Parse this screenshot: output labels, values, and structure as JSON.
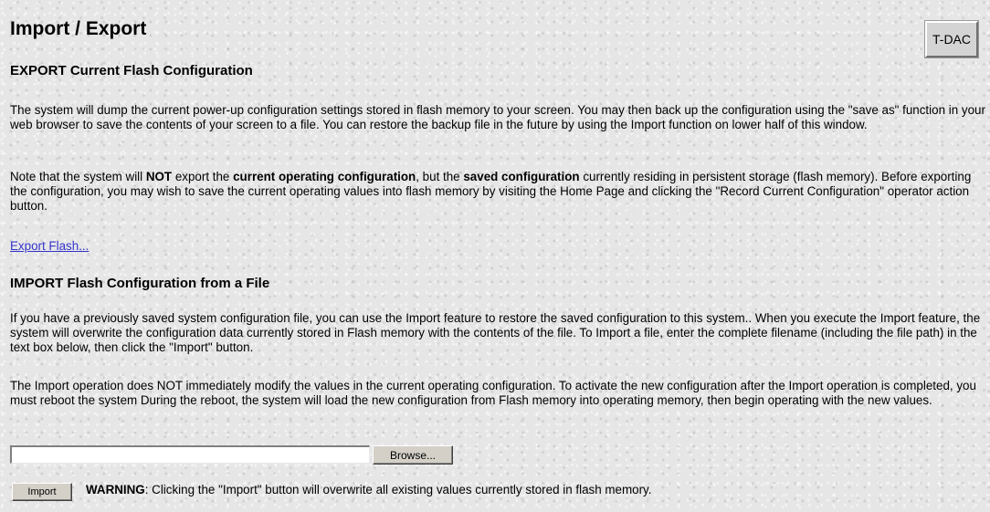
{
  "page": {
    "title": "Import / Export",
    "badge": "T-DAC"
  },
  "export": {
    "heading": "EXPORT Current Flash Configuration",
    "para1": "The system will dump the current power-up configuration settings stored in flash memory to your screen. You may then back up the configuration using the \"save as\" function in your web browser to save the contents of your screen to a file. You can restore the backup file in the future by using the Import function on lower half of this window.",
    "para2": {
      "t1": "Note that the system will ",
      "b1": "NOT",
      "t2": " export the ",
      "b2": "current operating configuration",
      "t3": ", but the ",
      "b3": "saved configuration",
      "t4": " currently residing in persistent storage (flash memory). Before exporting the configuration, you may wish to save the current operating values into flash memory by visiting the Home Page and clicking the \"Record Current Configuration\" operator action button."
    },
    "link": "Export Flash..."
  },
  "import": {
    "heading": "IMPORT Flash Configuration from a File",
    "para1": "If you have a previously saved system configuration file, you can use the Import feature to restore the saved configuration to this system.. When you execute the Import feature, the system will overwrite the configuration data currently stored in Flash memory with the contents of the file. To Import a file, enter the complete filename (including the file path) in the text box below, then click the \"Import\" button.",
    "para2": "The Import operation does NOT immediately modify the values in the current operating configuration. To activate the new configuration after the Import operation is completed, you must reboot the system During the reboot, the system will load the new configuration from Flash memory into operating memory, then begin operating with the new values.",
    "file_value": "",
    "browse_label": "Browse...",
    "import_label": "Import",
    "warning_label": "WARNING",
    "warning_text": ": Clicking the \"Import\" button will overwrite all existing values currently stored in flash memory."
  }
}
